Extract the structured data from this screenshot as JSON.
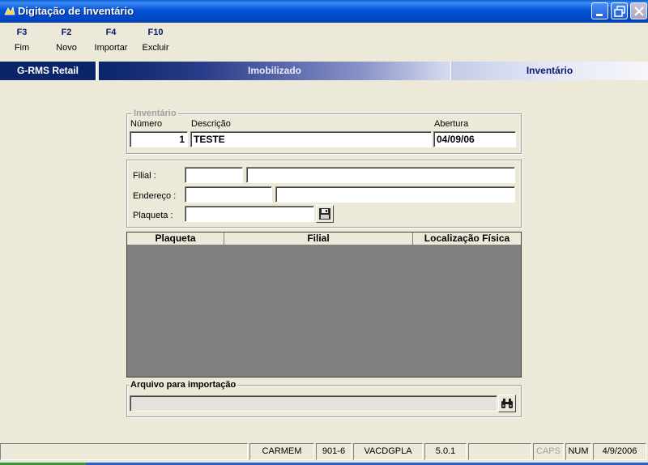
{
  "window": {
    "title": "Digitação de Inventário"
  },
  "toolbar": {
    "buttons": [
      {
        "key": "F3",
        "label": "Fim"
      },
      {
        "key": "F2",
        "label": "Novo"
      },
      {
        "key": "F4",
        "label": "Importar"
      },
      {
        "key": "F10",
        "label": "Excluir"
      }
    ]
  },
  "banner": {
    "app": "G-RMS Retail",
    "module": "Imobilizado",
    "screen": "Inventário"
  },
  "inventario": {
    "legend": "Inventário",
    "numero_label": "Número",
    "numero_value": "1",
    "descricao_label": "Descrição",
    "descricao_value": "TESTE",
    "abertura_label": "Abertura",
    "abertura_value": "04/09/06"
  },
  "filtros": {
    "filial_label": "Filial :",
    "filial_code": "",
    "filial_name": "",
    "endereco_label": "Endereço :",
    "endereco_code": "",
    "endereco_name": "",
    "plaqueta_label": "Plaqueta :",
    "plaqueta_value": ""
  },
  "grid": {
    "columns": [
      "Plaqueta",
      "Filial",
      "Localização Física"
    ],
    "rows": []
  },
  "importacao": {
    "legend": "Arquivo para importação",
    "file_value": ""
  },
  "statusbar": {
    "panels": [
      "",
      "CARMEM",
      "901-6",
      "VACDGPLA",
      "5.0.1",
      "",
      "CAPS",
      "NUM",
      "4/9/2006"
    ]
  },
  "colors": {
    "title_bar": "#0552d6",
    "banner_dark": "#0a246a",
    "grid_bg": "#808080",
    "window_bg": "#ece9d8"
  }
}
